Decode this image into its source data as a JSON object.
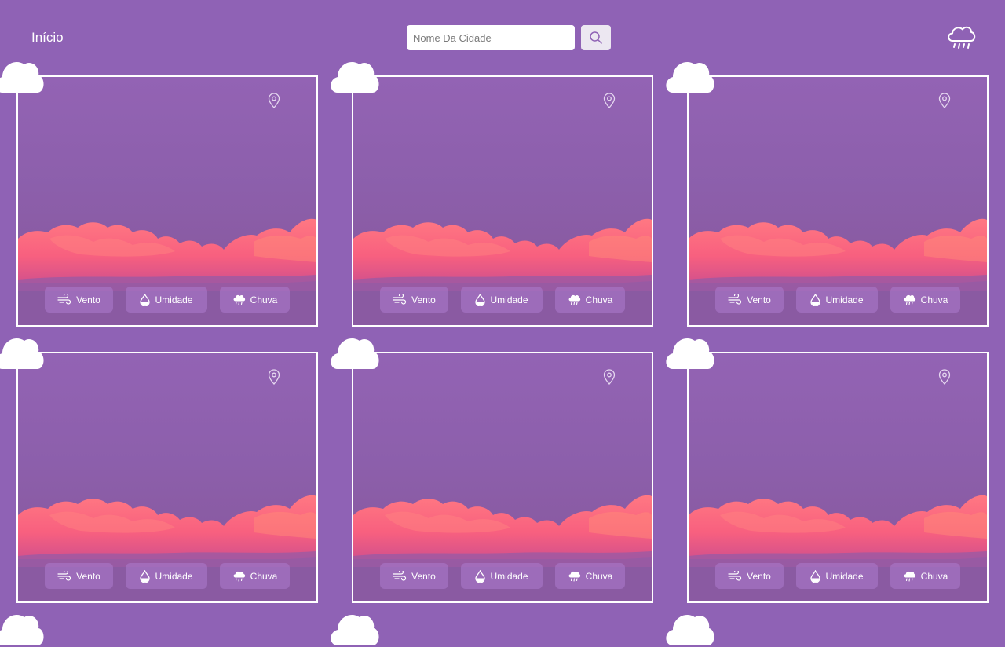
{
  "header": {
    "home_label": "Início",
    "search": {
      "placeholder": "Nome Da Cidade",
      "value": ""
    },
    "search_icon": "magnifier-icon",
    "logo_icon": "rain-cloud-icon"
  },
  "cards": [
    {
      "stats": {
        "wind": "Vento",
        "humidity": "Umidade",
        "rain": "Chuva"
      }
    },
    {
      "stats": {
        "wind": "Vento",
        "humidity": "Umidade",
        "rain": "Chuva"
      }
    },
    {
      "stats": {
        "wind": "Vento",
        "humidity": "Umidade",
        "rain": "Chuva"
      }
    },
    {
      "stats": {
        "wind": "Vento",
        "humidity": "Umidade",
        "rain": "Chuva"
      }
    },
    {
      "stats": {
        "wind": "Vento",
        "humidity": "Umidade",
        "rain": "Chuva"
      }
    },
    {
      "stats": {
        "wind": "Vento",
        "humidity": "Umidade",
        "rain": "Chuva"
      }
    }
  ],
  "colors": {
    "background": "#8f62b5",
    "card_border": "#ffffff",
    "clouds": "#ff6b7f",
    "stat_chip": "#aa78c8"
  },
  "icons": {
    "card_badge": "cloud-icon",
    "location": "location-pin-icon",
    "wind": "wind-icon",
    "humidity": "water-drop-icon",
    "rain": "rain-cloud-icon"
  }
}
